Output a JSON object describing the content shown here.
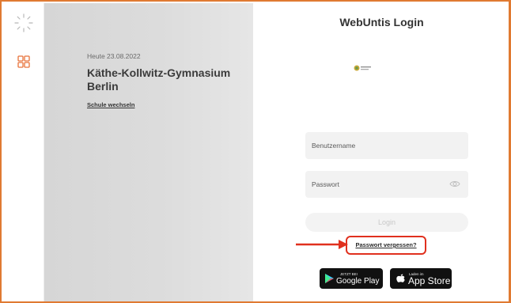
{
  "nav": {
    "spinner_icon": "loading-spinner-icon",
    "menu_icon": "grid-menu-icon",
    "accent_color": "#e07a32"
  },
  "school": {
    "date_line": "Heute 23.08.2022",
    "name": "Käthe-Kollwitz-Gymnasium Berlin",
    "change_link": "Schule wechseln"
  },
  "login": {
    "title": "WebUntis Login",
    "username_placeholder": "Benutzername",
    "password_placeholder": "Passwort",
    "password_eye_icon": "eye-icon",
    "login_button": "Login",
    "forgot_password": "Passwort vergessen?",
    "highlight_color": "#e0301e"
  },
  "stores": {
    "google": {
      "small": "JETZT BEI",
      "big": "Google Play"
    },
    "apple": {
      "small": "Laden im",
      "big": "App Store"
    }
  }
}
